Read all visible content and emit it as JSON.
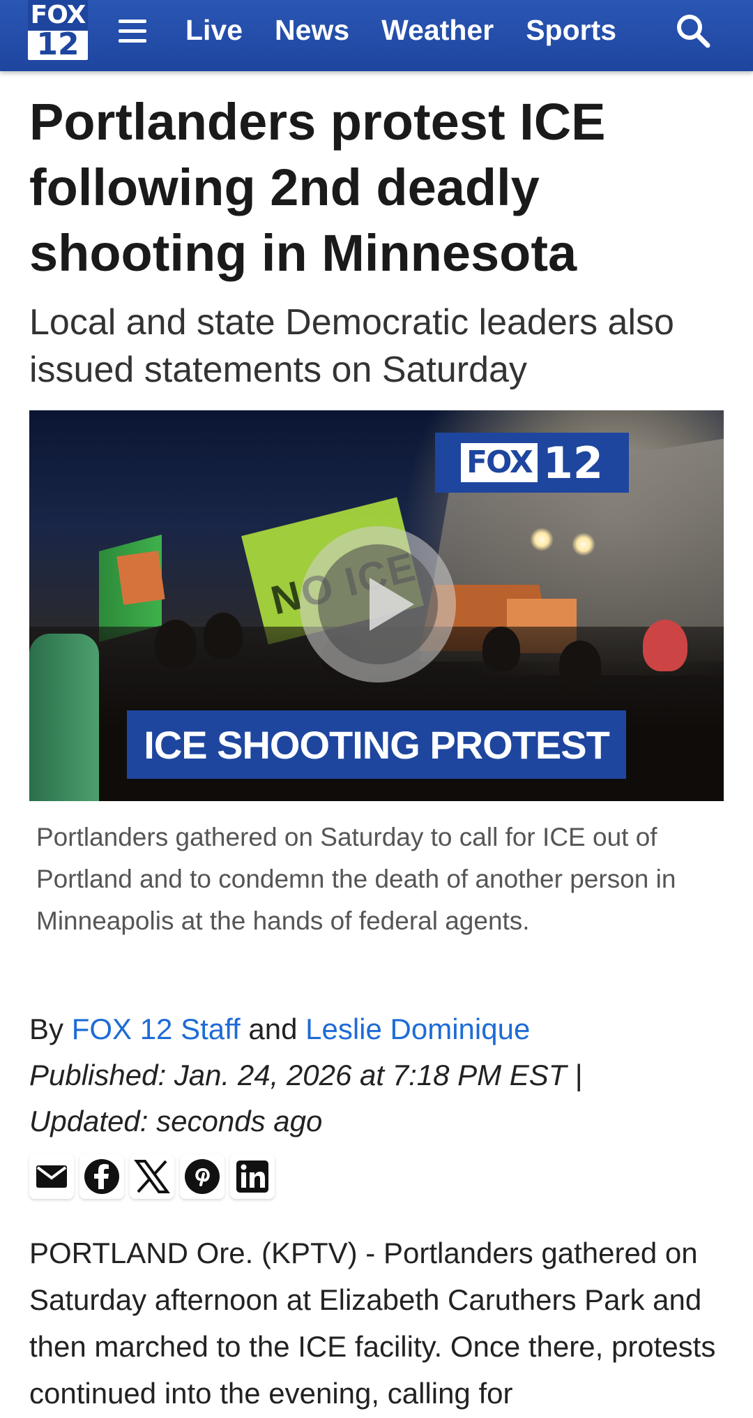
{
  "header": {
    "logo_top": "FOX",
    "logo_bottom": "12",
    "nav": [
      "Live",
      "News",
      "Weather",
      "Sports"
    ]
  },
  "article": {
    "headline": "Portlanders protest ICE following 2nd deadly shooting in Minnesota",
    "subheadline": "Local and state Democratic leaders also issued statements on Saturday",
    "video": {
      "brand_box": "FOX",
      "brand_num": "12",
      "banner": "ICE SHOOTING PROTEST",
      "sign_text": "NO ICE"
    },
    "caption": "Portlanders gathered on Saturday to call for ICE out of Portland and to condemn the death of another person in Minneapolis at the hands of federal agents.",
    "byline": {
      "by": "By",
      "author1": "FOX 12 Staff",
      "and": "and",
      "author2": "Leslie Dominique"
    },
    "published": "Published: Jan. 24, 2026 at 7:18 PM EST  |",
    "updated": "Updated: seconds ago",
    "body": "PORTLAND Ore. (KPTV) - Portlanders gathered on Saturday afternoon at Elizabeth Caruthers Park and then marched to the ICE facility. Once there, protests continued into the evening, calling for"
  },
  "colors": {
    "brand_blue": "#1e469f",
    "link_blue": "#1e6bd6"
  },
  "share_icons": [
    "email-icon",
    "facebook-icon",
    "x-icon",
    "pinterest-icon",
    "linkedin-icon"
  ]
}
